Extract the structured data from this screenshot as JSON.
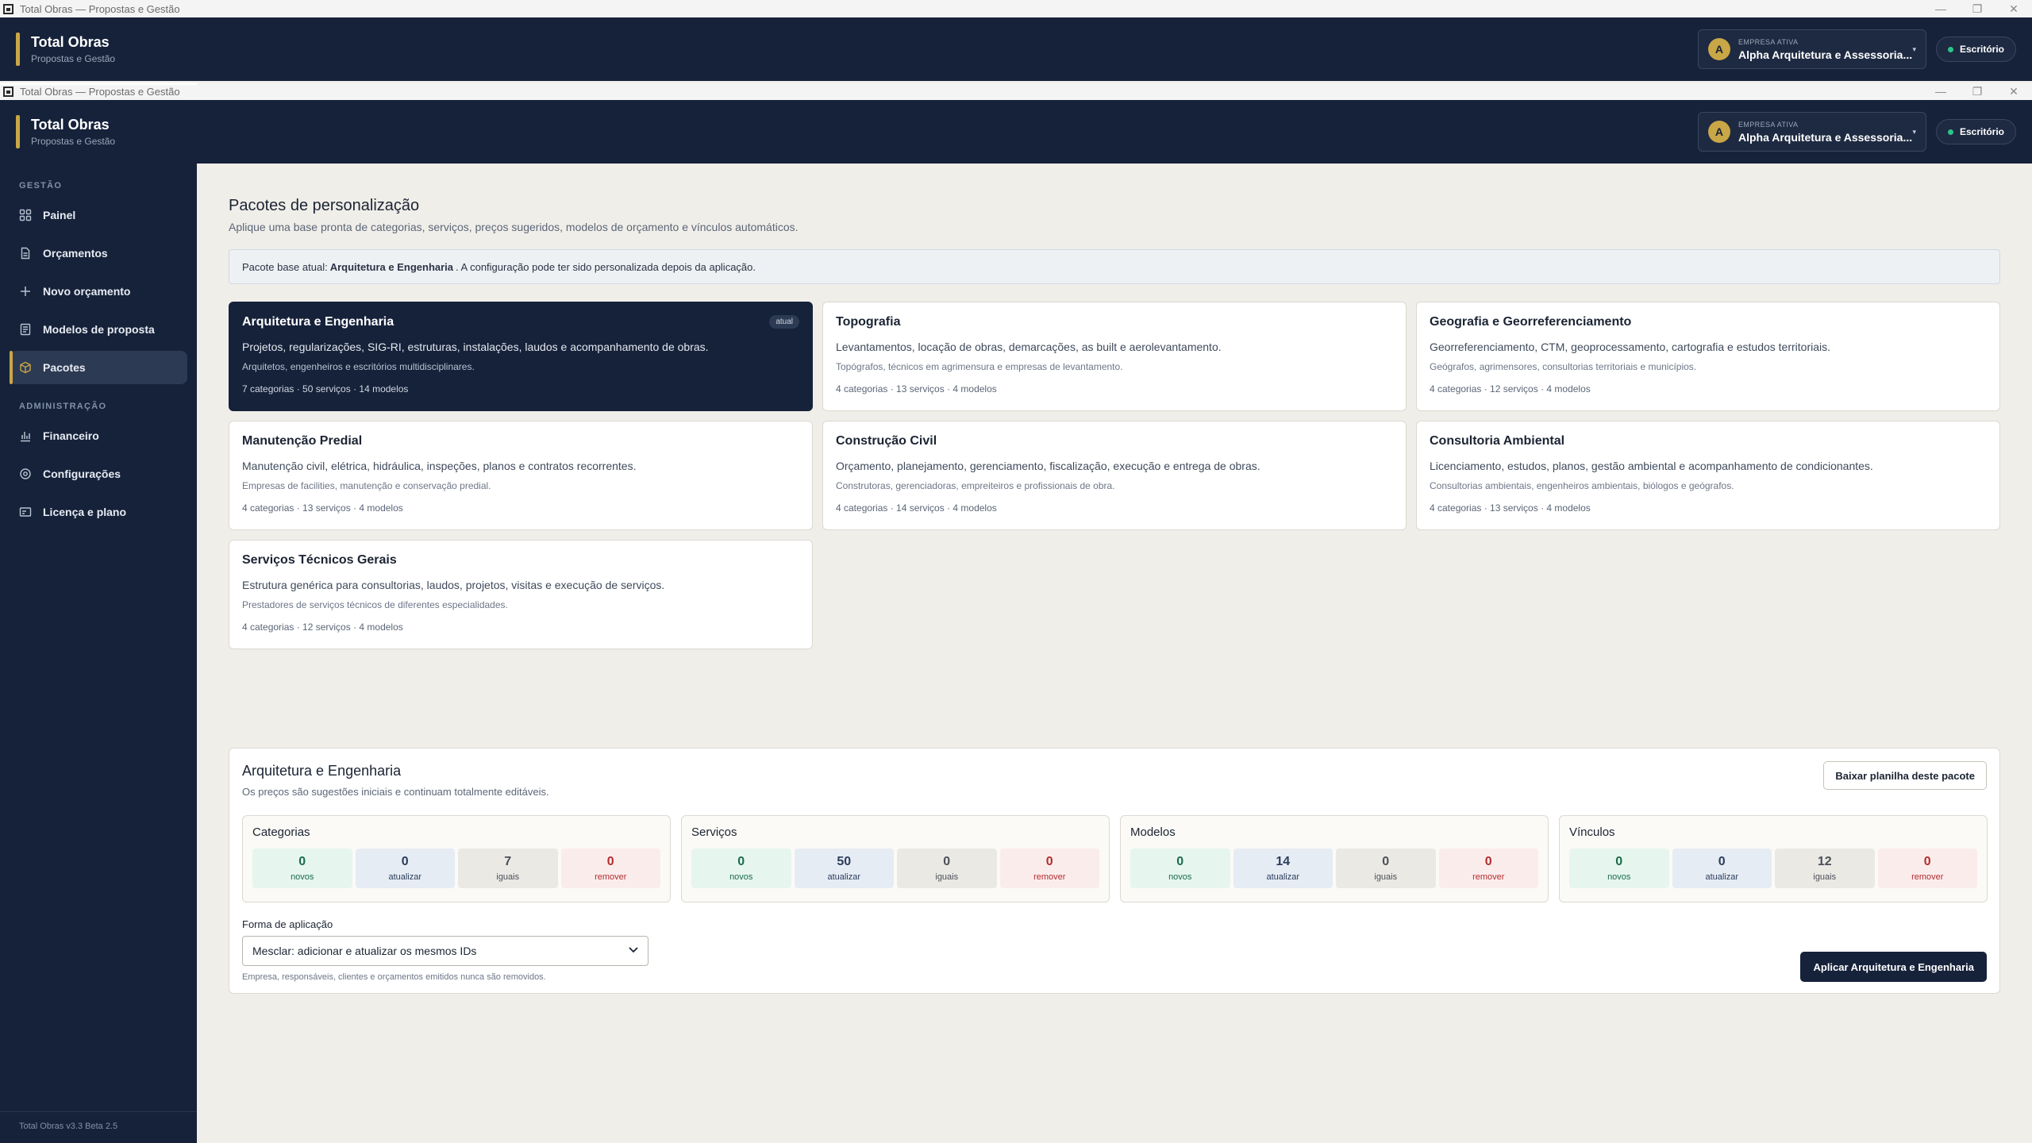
{
  "window": {
    "title": "Total Obras — Propostas e Gestão",
    "controls": {
      "minimize": "—",
      "restore": "❐",
      "close": "✕"
    }
  },
  "brand": {
    "name": "Total Obras",
    "subtitle": "Propostas e Gestão"
  },
  "company": {
    "label": "EMPRESA ATIVA",
    "initial": "A",
    "name": "Alpha Arquitetura e Assessoria...",
    "caret": "▾"
  },
  "mode_pill": {
    "label": "Escritório"
  },
  "sidebar": {
    "section_gestao": "GESTÃO",
    "section_admin": "ADMINISTRAÇÃO",
    "items": [
      {
        "label": "Painel",
        "icon": "grid-icon"
      },
      {
        "label": "Orçamentos",
        "icon": "document-icon"
      },
      {
        "label": "Novo orçamento",
        "icon": "plus-icon"
      },
      {
        "label": "Modelos de proposta",
        "icon": "template-icon"
      },
      {
        "label": "Pacotes",
        "icon": "package-icon",
        "active": true
      },
      {
        "label": "Financeiro",
        "icon": "chart-icon"
      },
      {
        "label": "Configurações",
        "icon": "gear-icon"
      },
      {
        "label": "Licença e plano",
        "icon": "license-icon"
      }
    ],
    "footer": "Total Obras v3.3 Beta 2.5"
  },
  "page": {
    "title": "Pacotes de personalização",
    "subtitle": "Aplique uma base pronta de categorias, serviços, preços sugeridos, modelos de orçamento e vínculos automáticos."
  },
  "notice": {
    "prefix": "Pacote base atual:",
    "package": "Arquitetura e Engenharia",
    "suffix": ". A configuração pode ter sido personalizada depois da aplicação."
  },
  "cards": [
    {
      "title": "Arquitetura e Engenharia",
      "desc": "Projetos, regularizações, SIG-RI, estruturas, instalações, laudos e acompanhamento de obras.",
      "audience": "Arquitetos, engenheiros e escritórios multidisciplinares.",
      "stats": "7 categorias · 50 serviços · 14 modelos",
      "badge": "atual"
    },
    {
      "title": "Topografia",
      "desc": "Levantamentos, locação de obras, demarcações, as built e aerolevantamento.",
      "audience": "Topógrafos, técnicos em agrimensura e empresas de levantamento.",
      "stats": "4 categorias · 13 serviços · 4 modelos"
    },
    {
      "title": "Geografia e Georreferenciamento",
      "desc": "Georreferenciamento, CTM, geoprocessamento, cartografia e estudos territoriais.",
      "audience": "Geógrafos, agrimensores, consultorias territoriais e municípios.",
      "stats": "4 categorias · 12 serviços · 4 modelos"
    },
    {
      "title": "Manutenção Predial",
      "desc": "Manutenção civil, elétrica, hidráulica, inspeções, planos e contratos recorrentes.",
      "audience": "Empresas de facilities, manutenção e conservação predial.",
      "stats": "4 categorias · 13 serviços · 4 modelos"
    },
    {
      "title": "Construção Civil",
      "desc": "Orçamento, planejamento, gerenciamento, fiscalização, execução e entrega de obras.",
      "audience": "Construtoras, gerenciadoras, empreiteiros e profissionais de obra.",
      "stats": "4 categorias · 14 serviços · 4 modelos"
    },
    {
      "title": "Consultoria Ambiental",
      "desc": "Licenciamento, estudos, planos, gestão ambiental e acompanhamento de condicionantes.",
      "audience": "Consultorias ambientais, engenheiros ambientais, biólogos e geógrafos.",
      "stats": "4 categorias · 13 serviços · 4 modelos"
    },
    {
      "title": "Serviços Técnicos Gerais",
      "desc": "Estrutura genérica para consultorias, laudos, projetos, visitas e execução de serviços.",
      "audience": "Prestadores de serviços técnicos de diferentes especialidades.",
      "stats": "4 categorias · 12 serviços · 4 modelos"
    }
  ],
  "detail": {
    "title": "Arquitetura e Engenharia",
    "subtitle": "Os preços são sugestões iniciais e continuam totalmente editáveis.",
    "download_label": "Baixar planilha deste pacote",
    "stat_labels": {
      "new": "novos",
      "update": "atualizar",
      "same": "iguais",
      "remove": "remover"
    },
    "groups": [
      {
        "title": "Categorias",
        "new": "0",
        "update": "0",
        "same": "7",
        "remove": "0"
      },
      {
        "title": "Serviços",
        "new": "0",
        "update": "50",
        "same": "0",
        "remove": "0"
      },
      {
        "title": "Modelos",
        "new": "0",
        "update": "14",
        "same": "0",
        "remove": "0"
      },
      {
        "title": "Vínculos",
        "new": "0",
        "update": "0",
        "same": "12",
        "remove": "0"
      }
    ],
    "form_label": "Forma de aplicação",
    "select_value": "Mesclar: adicionar e atualizar os mesmos IDs",
    "note": "Empresa, responsáveis, clientes e orçamentos emitidos nunca são removidos.",
    "apply_label": "Aplicar Arquitetura e Engenharia"
  }
}
